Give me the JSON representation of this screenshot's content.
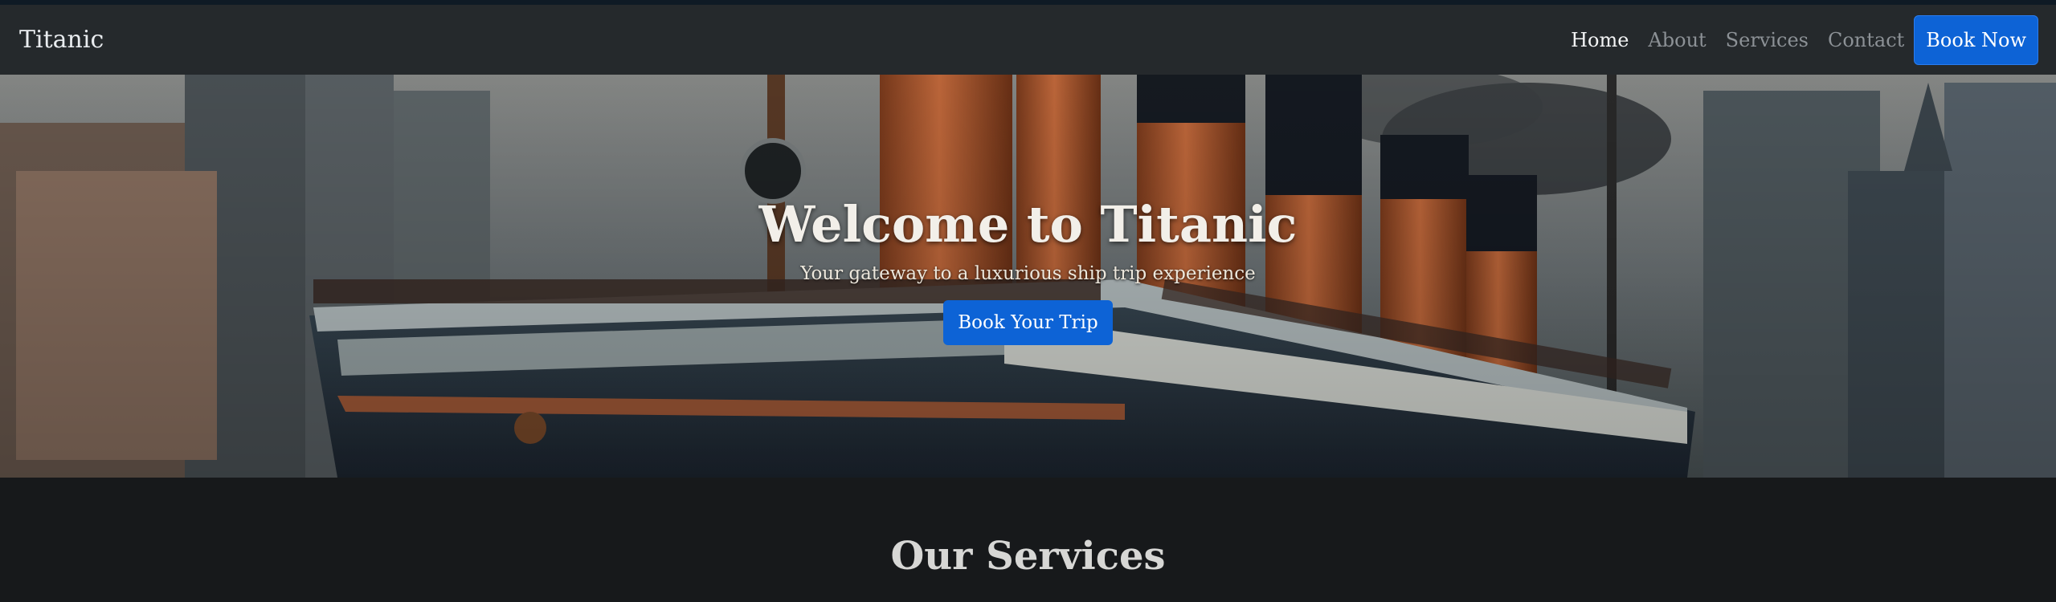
{
  "navbar": {
    "brand": "Titanic",
    "links": [
      {
        "label": "Home",
        "active": true
      },
      {
        "label": "About",
        "active": false
      },
      {
        "label": "Services",
        "active": false
      },
      {
        "label": "Contact",
        "active": false
      }
    ],
    "cta_label": "Book Now"
  },
  "hero": {
    "title": "Welcome to Titanic",
    "subtitle": "Your gateway to a luxurious ship trip experience",
    "button_label": "Book Your Trip"
  },
  "services": {
    "title": "Our Services"
  },
  "colors": {
    "primary": "#0d63d6",
    "navbar_bg": "#25292c",
    "page_bg": "#17191b"
  }
}
